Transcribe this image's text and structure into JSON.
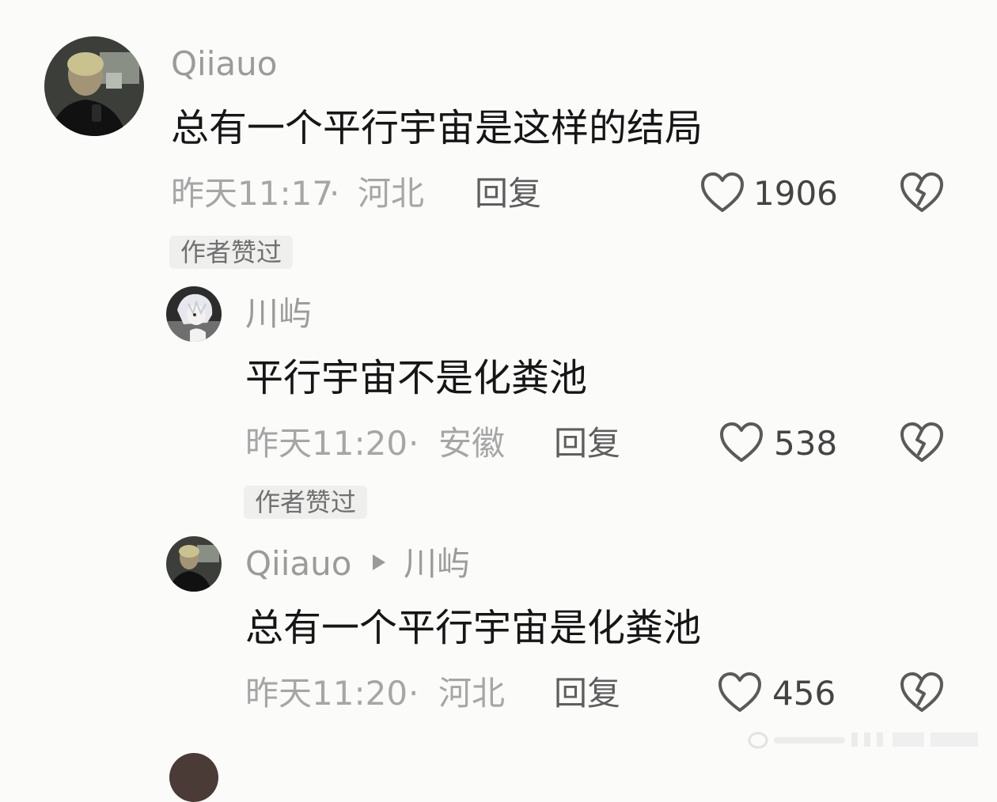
{
  "comments": [
    {
      "username": "Qiiauo",
      "text": "总有一个平行宇宙是这样的结局",
      "time": "昨天11:17",
      "separator": "·",
      "location": "河北",
      "reply_label": "回复",
      "likes": "1906",
      "badge": "作者赞过"
    },
    {
      "username": "川屿",
      "text": "平行宇宙不是化粪池",
      "time": "昨天11:20",
      "separator": "·",
      "location": "安徽",
      "reply_label": "回复",
      "likes": "538",
      "badge": "作者赞过"
    },
    {
      "username": "Qiiauo",
      "reply_to": "川屿",
      "text": "总有一个平行宇宙是化粪池",
      "time": "昨天11:20",
      "separator": "·",
      "location": "河北",
      "reply_label": "回复",
      "likes": "456"
    }
  ],
  "icons": {
    "like": "heart-outline-icon",
    "dislike": "broken-heart-icon",
    "reply_arrow": "play-triangle-icon"
  },
  "colors": {
    "background": "#fbfbfa",
    "username": "#9b9b9b",
    "text": "#161616",
    "meta": "#a6a6a6",
    "badge_bg": "#efefee"
  }
}
